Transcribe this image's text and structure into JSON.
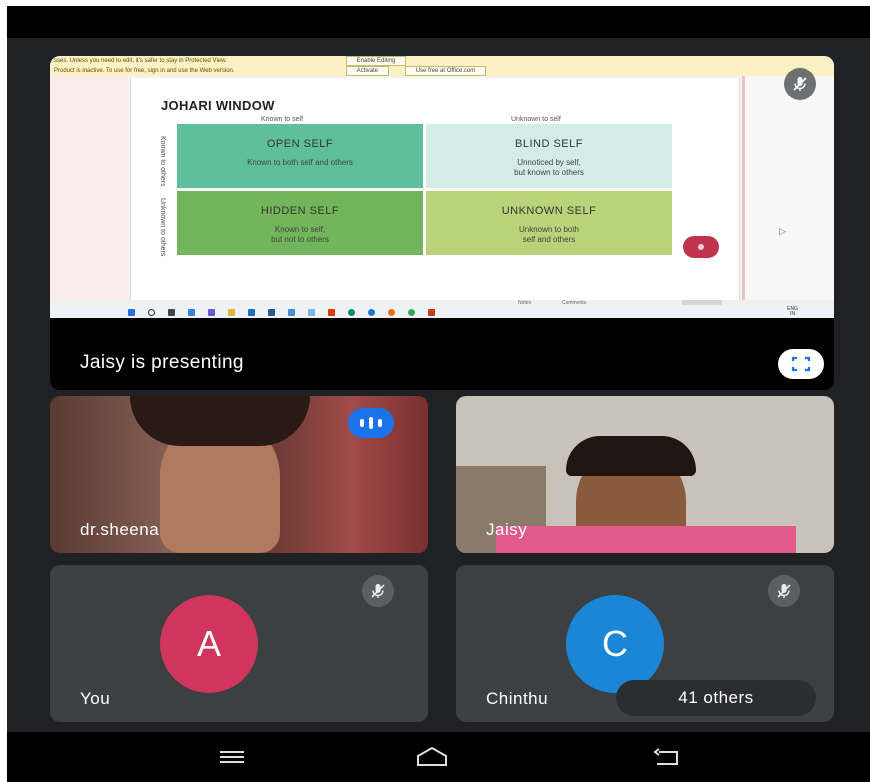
{
  "presentation": {
    "warning_bar_1": {
      "message": "sses. Unless you need to edit, it's safer to stay in Protected View.",
      "button": "Enable Editing"
    },
    "warning_bar_2": {
      "message": "Product is inactive. To use for free, sign in and use the Web version.",
      "buttons": [
        "Activate",
        "Use free at Office.com"
      ]
    },
    "slide": {
      "title": "JOHARI WINDOW",
      "col_headers": [
        "Known to self",
        "Unknown to self"
      ],
      "row_headers": [
        "Known to others",
        "Unknown to others"
      ],
      "cells": [
        {
          "title": "OPEN SELF",
          "subtitle": "Known to both self and others"
        },
        {
          "title": "BLIND SELF",
          "subtitle_lines": [
            "Unnoticed by self,",
            "but known to others"
          ]
        },
        {
          "title": "HIDDEN SELF",
          "subtitle_lines": [
            "Known to self,",
            "but not to others"
          ]
        },
        {
          "title": "UNKNOWN SELF",
          "subtitle_lines": [
            "Unknown to both",
            "self and others"
          ]
        }
      ]
    },
    "status_bar": {
      "notes": "Notes",
      "comments": "Comments"
    },
    "taskbar_tray": {
      "lang_line1": "ENG",
      "lang_line2": "IN"
    },
    "label": "Jaisy is presenting"
  },
  "participants": [
    {
      "name": "dr.sheena",
      "speaking": true
    },
    {
      "name": "Jaisy"
    },
    {
      "name": "You",
      "avatar_letter": "A",
      "avatar_color": "#d0365c",
      "muted": true
    },
    {
      "name": "Chinthu",
      "avatar_letter": "C",
      "avatar_color": "#1b86d6",
      "muted": true
    }
  ],
  "others_chip": "41 others",
  "icons": {
    "mic_off": "mic-off-icon",
    "fullscreen": "fullscreen-icon",
    "speaking": "speaking-indicator-icon",
    "nav": [
      "menu-icon",
      "home-icon",
      "back-icon"
    ]
  },
  "colors": {
    "accent_blue": "#1a73e8",
    "meet_bg": "#202124",
    "tile_bg": "#3c4043"
  }
}
